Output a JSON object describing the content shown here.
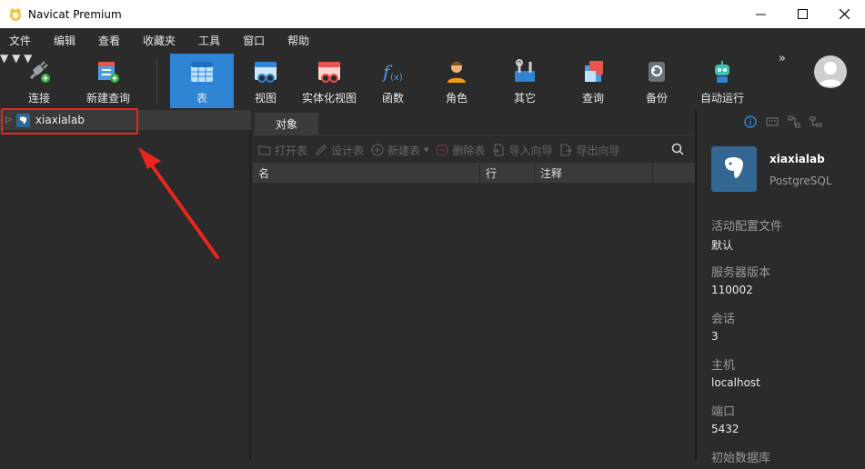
{
  "window": {
    "title": "Navicat Premium"
  },
  "menu": [
    "文件",
    "编辑",
    "查看",
    "收藏夹",
    "工具",
    "窗口",
    "帮助"
  ],
  "toolbar": {
    "connect": "连接",
    "new_query": "新建查询",
    "table": "表",
    "view": "视图",
    "materialized_view": "实体化视图",
    "function": "函数",
    "role": "角色",
    "other": "其它",
    "query": "查询",
    "backup": "备份",
    "automation": "自动运行",
    "more": "»"
  },
  "tree": {
    "connection": "xiaxialab"
  },
  "objects": {
    "tab": "对象",
    "actions": {
      "open_table": "打开表",
      "design_table": "设计表",
      "new_table": "新建表",
      "delete_table": "删除表",
      "import_wizard": "导入向导",
      "export_wizard": "导出向导"
    },
    "columns": [
      "名",
      "行",
      "注释"
    ]
  },
  "info": {
    "name": "xiaxialab",
    "type": "PostgreSQL",
    "props": [
      {
        "label": "活动配置文件",
        "value": "默认"
      },
      {
        "label": "服务器版本",
        "value": "110002"
      },
      {
        "label": "会话",
        "value": "3"
      },
      {
        "label": "主机",
        "value": "localhost"
      },
      {
        "label": "端口",
        "value": "5432"
      },
      {
        "label": "初始数据库",
        "value": ""
      }
    ]
  },
  "colors": {
    "accent": "#2f84d4",
    "highlight": "#e8271c",
    "postgres": "#336791"
  }
}
